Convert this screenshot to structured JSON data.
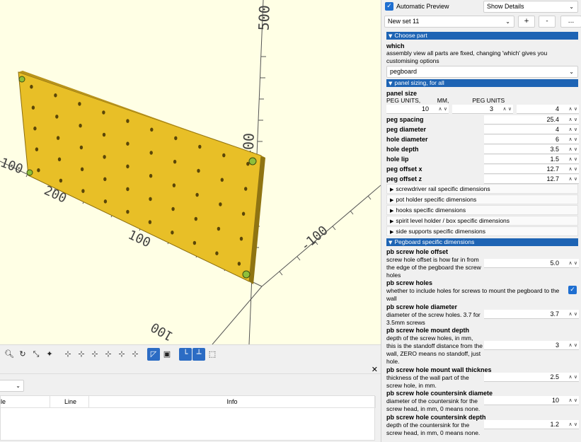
{
  "viewport": {
    "axis_labels": [
      "500",
      "400",
      "300",
      "200",
      "100",
      "-100",
      "100",
      "100"
    ]
  },
  "toolbar": {
    "icons": [
      "zoom-all-icon",
      "reset-view-icon",
      "view-all-icon",
      "diagonal-view-icon",
      "view-right-icon",
      "view-top-icon",
      "view-bottom-icon",
      "view-left-icon",
      "view-front-icon",
      "view-back-icon",
      "perspective-icon",
      "orthogonal-icon",
      "show-axes-icon",
      "show-scale-icon",
      "show-edges-icon"
    ]
  },
  "console": {
    "columns": [
      "le",
      "Line",
      "Info"
    ]
  },
  "customizer": {
    "auto_preview_label": "Automatic Preview",
    "details_select": "Show Details",
    "preset_select": "New set 11",
    "add_btn": "+",
    "remove_btn": "-",
    "more_btn": "...",
    "section_choose": "Choose part",
    "which_label": "which",
    "which_desc": "assembly view all parts are fixed, changing 'which' gives you customising options",
    "which_value": "pegboard",
    "section_sizing": "panel sizing, for all",
    "panel_size_label": "panel size",
    "panel_size_desc": "PEG UNITS,          MM,              PEG UNITS",
    "panel_size_values": [
      "10",
      "3",
      "4"
    ],
    "params": [
      {
        "label": "peg spacing",
        "value": "25.4"
      },
      {
        "label": "peg diameter",
        "value": "4"
      },
      {
        "label": "hole diameter",
        "value": "6"
      },
      {
        "label": "hole depth",
        "value": "3.5"
      },
      {
        "label": "hole lip",
        "value": "1.5"
      },
      {
        "label": "peg offset x",
        "value": "12.7"
      },
      {
        "label": "peg offset z",
        "value": "12.7"
      }
    ],
    "subsections": [
      "screwdriver rail specific dimensions",
      "pot holder specific dimensions",
      "hooks specific dimensions",
      "spirit level holder / box specific dimensions",
      "side supports specific dimensions"
    ],
    "section_pegboard": "Pegboard specific dimensions",
    "pb": {
      "offset_label": "pb screw hole offset",
      "offset_desc": [
        "screw hole offset is how far in from",
        "the edge of the pegboard the screw",
        "holes"
      ],
      "offset_value": "5.0",
      "holes_label": "pb screw holes",
      "holes_desc": [
        "whether to include holes for screws to mount the pegboard to the",
        "wall"
      ],
      "diam_label": "pb screw hole diameter",
      "diam_desc": [
        "diameter of the screw holes.  3.7 for",
        "3.5mm screws"
      ],
      "diam_value": "3.7",
      "mount_label": "pb screw hole mount depth",
      "mount_desc": [
        "depth of the screw holes, in mm,",
        "this is the standoff distance from the",
        "wall, ZERO means no standoff, just",
        "hole."
      ],
      "mount_value": "3",
      "wall_label": "pb screw hole mount wall thicknes",
      "wall_desc": [
        "thickness of the wall part of the",
        "screw hole, in mm."
      ],
      "wall_value": "2.5",
      "csd_label": "pb screw hole countersink diamete",
      "csd_desc": [
        "diameter of the countersink for the",
        "screw head, in mm, 0 means none."
      ],
      "csd_value": "10",
      "csdp_label": "pb screw hole countersink depth",
      "csdp_desc": [
        "depth of the countersink for the",
        "screw head, in mm, 0 means none."
      ],
      "csdp_value": "1.2"
    }
  }
}
